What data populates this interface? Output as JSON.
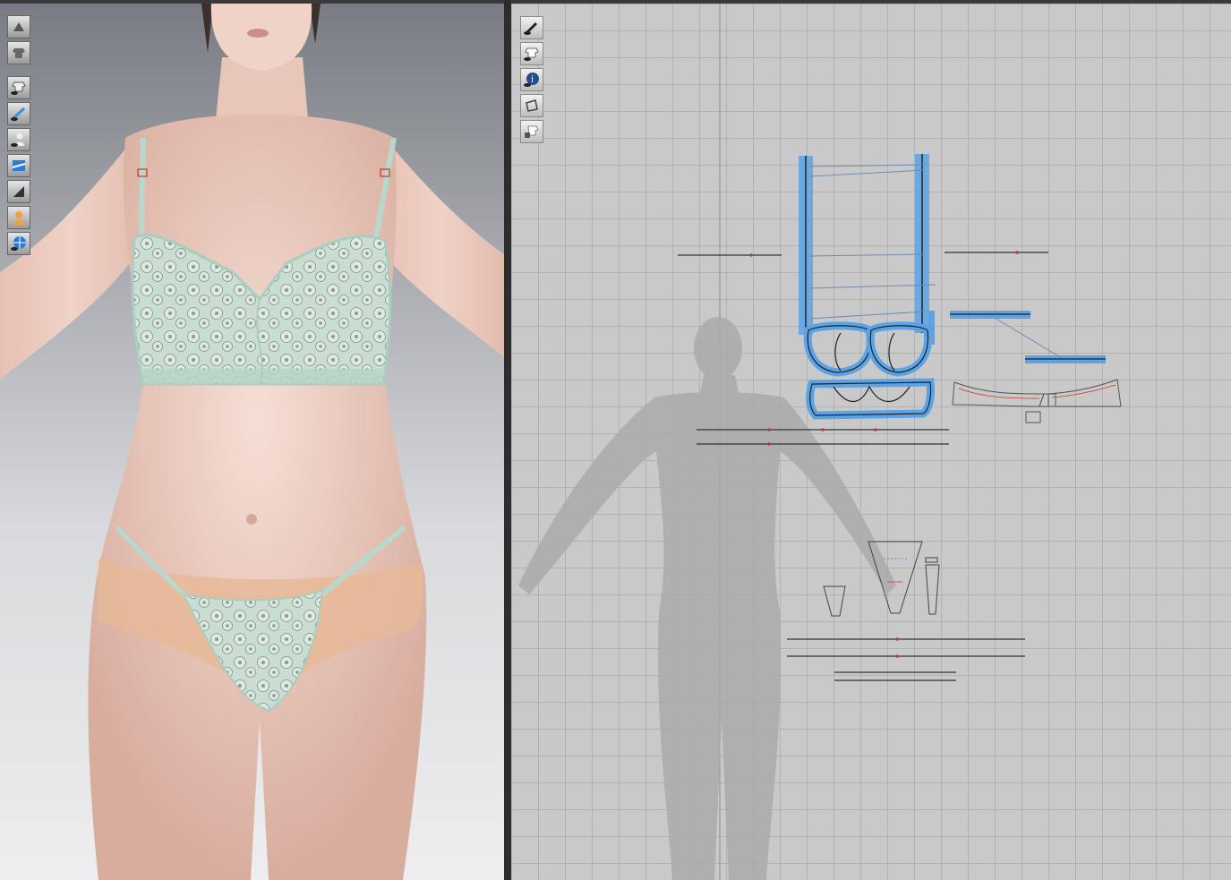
{
  "app": {
    "name": ""
  },
  "viewport_3d": {
    "toolbar": [
      {
        "icon": "render-mode-icon",
        "active": false
      },
      {
        "icon": "garment-show-icon",
        "active": false
      },
      {
        "icon": "show-garment-eye-icon",
        "active": false
      },
      {
        "icon": "show-pins-icon",
        "active": true
      },
      {
        "icon": "show-avatar-icon",
        "active": false
      },
      {
        "icon": "texture-fabric-icon",
        "active": true
      },
      {
        "icon": "shading-icon",
        "active": false
      },
      {
        "icon": "avatar-skin-icon",
        "active": true
      },
      {
        "icon": "environment-globe-icon",
        "active": true
      }
    ]
  },
  "viewport_2d": {
    "toolbar": [
      {
        "icon": "edit-pen-icon"
      },
      {
        "icon": "garment-shirt-icon"
      },
      {
        "icon": "info-icon"
      },
      {
        "icon": "pattern-piece-icon"
      },
      {
        "icon": "locked-garment-icon"
      }
    ]
  },
  "colors": {
    "selection_blue": "#5aa3e6",
    "seam_red": "#c0392b",
    "grid_bg": "#c9c9c9",
    "fabric_mint": "#bcd9cc"
  }
}
